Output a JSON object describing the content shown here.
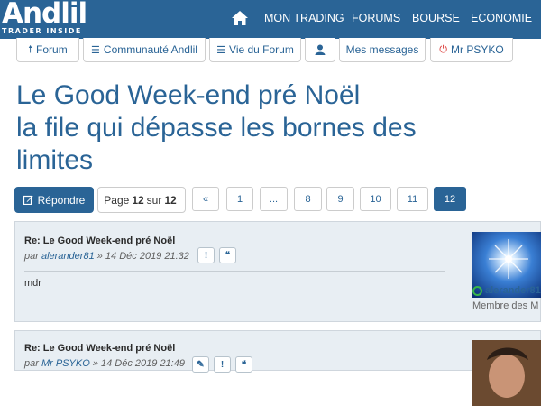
{
  "brand": {
    "logo_name": "Andlil",
    "tagline": "TRADER INSIDE"
  },
  "nav": {
    "home_icon": "home-icon",
    "items": [
      "MON TRADING",
      "FORUMS",
      "BOURSE",
      "ECONOMIE"
    ]
  },
  "subnav": [
    {
      "label": "Forum",
      "icon": "arrow-up-icon"
    },
    {
      "label": "Communauté Andlil",
      "icon": "list-icon"
    },
    {
      "label": "Vie du Forum",
      "icon": "list-icon"
    },
    {
      "label": "",
      "icon": "user-icon"
    },
    {
      "label": "Mes messages",
      "icon": ""
    },
    {
      "label": "Mr PSYKO",
      "icon": "power-icon"
    }
  ],
  "topic": {
    "title_lines": [
      "Le Good Week-end pré Noël",
      "la file qui dépasse les bornes des",
      "limites"
    ]
  },
  "toolbar": {
    "reply_label": "Répondre",
    "page_word": "Page",
    "current_page": "12",
    "of_word": "sur",
    "total_pages": "12"
  },
  "pagination": [
    "«",
    "1",
    "...",
    "8",
    "9",
    "10",
    "11",
    "12"
  ],
  "accent_color": "#2a6496",
  "posts": [
    {
      "title": "Re: Le Good Week-end pré Noël",
      "by": "par",
      "author": "alerander81",
      "date": "» 14 Déc 2019 21:32",
      "body": "mdr",
      "username": "alerander81",
      "rank": "Membre des M"
    },
    {
      "title": "Re: Le Good Week-end pré Noël",
      "by": "par",
      "author": "Mr PSYKO",
      "date": "» 14 Déc 2019 21:49"
    }
  ]
}
